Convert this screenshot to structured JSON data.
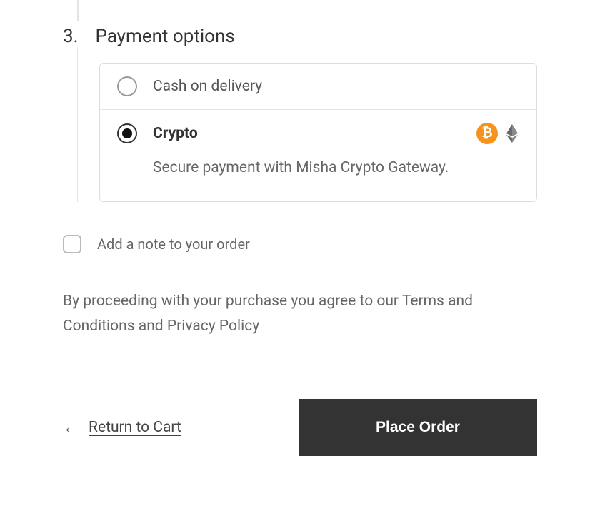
{
  "step": {
    "number": "3.",
    "title": "Payment options"
  },
  "payment_options": [
    {
      "label": "Cash on delivery",
      "selected": false
    },
    {
      "label": "Crypto",
      "selected": true,
      "description": "Secure payment with Misha Crypto Gateway."
    }
  ],
  "icons": {
    "bitcoin_glyph": "₿"
  },
  "note": {
    "label": "Add a note to your order"
  },
  "terms_text": "By proceeding with your purchase you agree to our Terms and Conditions and Privacy Policy",
  "actions": {
    "return_label": "Return to Cart",
    "place_order_label": "Place Order"
  }
}
